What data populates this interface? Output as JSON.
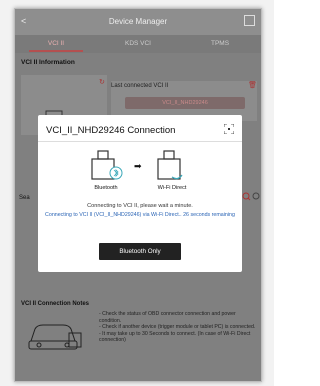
{
  "header": {
    "title": "Device Manager",
    "back": "<"
  },
  "tabs": [
    {
      "label": "VCI II"
    },
    {
      "label": "KDS VCI"
    },
    {
      "label": "TPMS"
    }
  ],
  "sections": {
    "vci_info": "VCI II Information",
    "search_prefix": "Sea",
    "notes_title": "VCI II Connection Notes"
  },
  "last_connected": {
    "label": "Last connected VCI II",
    "value": "VCI_II_NHD29246"
  },
  "notes": {
    "line1": "- Check the status of OBD connector connection and power condition.",
    "line2": "- Check if another device (trigger module or tablet PC) is connected.",
    "line3": "- It may take up to 30 Seconds to connect. (In case of Wi-Fi Direct connection)"
  },
  "modal": {
    "title": "VCI_II_NHD29246 Connection",
    "left_device": "Bluetooth",
    "right_device": "Wi-Fi Direct",
    "status_line": "Connecting to VCI II, please wait a minute.",
    "detail_line": "Connecting to VCI II (VCI_II_NHD29246) via Wi-Fi Direct.. 26 seconds remaining",
    "button": "Bluetooth Only"
  }
}
